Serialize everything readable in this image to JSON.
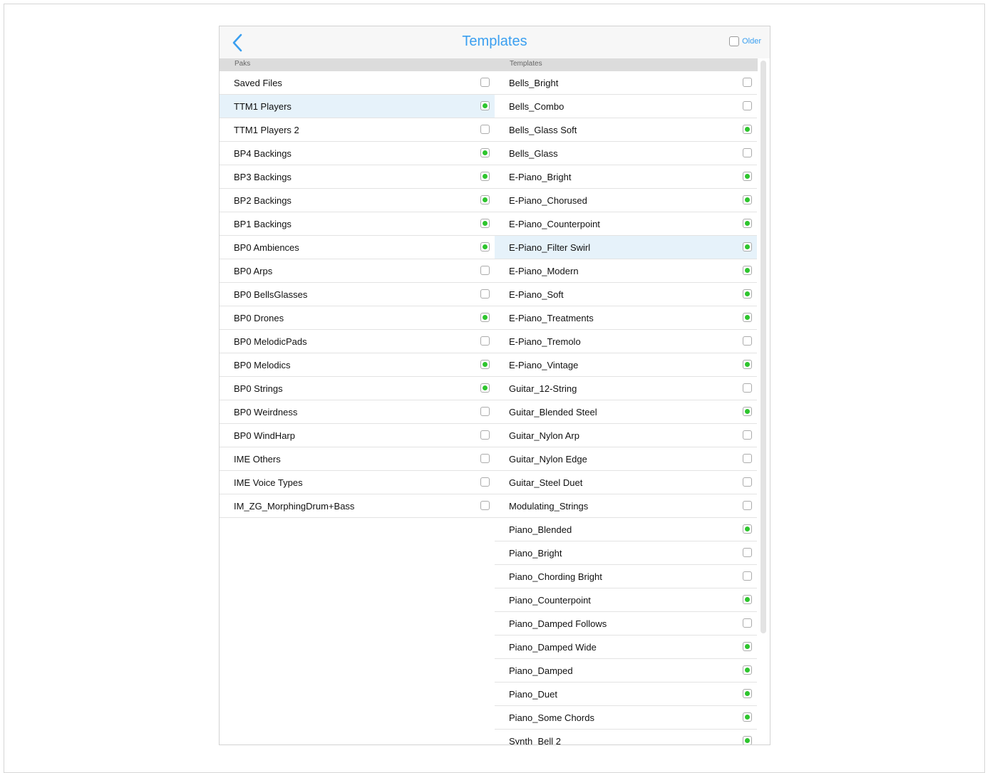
{
  "nav": {
    "title": "Templates",
    "older_label": "Older"
  },
  "columns": {
    "paks_header": "Paks",
    "templates_header": "Templates"
  },
  "colors": {
    "accent": "#3a9ff0",
    "enabled_dot": "#2ec52e",
    "selected_row": "#e6f2fa"
  },
  "paks": [
    {
      "label": "Saved Files",
      "checked": false,
      "selected": false
    },
    {
      "label": "TTM1 Players",
      "checked": true,
      "selected": true
    },
    {
      "label": "TTM1 Players 2",
      "checked": false,
      "selected": false
    },
    {
      "label": "BP4 Backings",
      "checked": true,
      "selected": false
    },
    {
      "label": "BP3 Backings",
      "checked": true,
      "selected": false
    },
    {
      "label": "BP2 Backings",
      "checked": true,
      "selected": false
    },
    {
      "label": "BP1 Backings",
      "checked": true,
      "selected": false
    },
    {
      "label": "BP0 Ambiences",
      "checked": true,
      "selected": false
    },
    {
      "label": "BP0 Arps",
      "checked": false,
      "selected": false
    },
    {
      "label": "BP0 BellsGlasses",
      "checked": false,
      "selected": false
    },
    {
      "label": "BP0 Drones",
      "checked": true,
      "selected": false
    },
    {
      "label": "BP0 MelodicPads",
      "checked": false,
      "selected": false
    },
    {
      "label": "BP0 Melodics",
      "checked": true,
      "selected": false
    },
    {
      "label": "BP0 Strings",
      "checked": true,
      "selected": false
    },
    {
      "label": "BP0 Weirdness",
      "checked": false,
      "selected": false
    },
    {
      "label": "BP0 WindHarp",
      "checked": false,
      "selected": false
    },
    {
      "label": "IME Others",
      "checked": false,
      "selected": false
    },
    {
      "label": "IME Voice Types",
      "checked": false,
      "selected": false
    },
    {
      "label": "IM_ZG_MorphingDrum+Bass",
      "checked": false,
      "selected": false
    }
  ],
  "templates": [
    {
      "label": "Bells_Bright",
      "checked": false,
      "selected": false
    },
    {
      "label": "Bells_Combo",
      "checked": false,
      "selected": false
    },
    {
      "label": "Bells_Glass Soft",
      "checked": true,
      "selected": false
    },
    {
      "label": "Bells_Glass",
      "checked": false,
      "selected": false
    },
    {
      "label": "E-Piano_Bright",
      "checked": true,
      "selected": false
    },
    {
      "label": "E-Piano_Chorused",
      "checked": true,
      "selected": false
    },
    {
      "label": "E-Piano_Counterpoint",
      "checked": true,
      "selected": false
    },
    {
      "label": "E-Piano_Filter Swirl",
      "checked": true,
      "selected": true
    },
    {
      "label": "E-Piano_Modern",
      "checked": true,
      "selected": false
    },
    {
      "label": "E-Piano_Soft",
      "checked": true,
      "selected": false
    },
    {
      "label": "E-Piano_Treatments",
      "checked": true,
      "selected": false
    },
    {
      "label": "E-Piano_Tremolo",
      "checked": false,
      "selected": false
    },
    {
      "label": "E-Piano_Vintage",
      "checked": true,
      "selected": false
    },
    {
      "label": "Guitar_12-String",
      "checked": false,
      "selected": false
    },
    {
      "label": "Guitar_Blended Steel",
      "checked": true,
      "selected": false
    },
    {
      "label": "Guitar_Nylon Arp",
      "checked": false,
      "selected": false
    },
    {
      "label": "Guitar_Nylon Edge",
      "checked": false,
      "selected": false
    },
    {
      "label": "Guitar_Steel Duet",
      "checked": false,
      "selected": false
    },
    {
      "label": "Modulating_Strings",
      "checked": false,
      "selected": false
    },
    {
      "label": "Piano_Blended",
      "checked": true,
      "selected": false
    },
    {
      "label": "Piano_Bright",
      "checked": false,
      "selected": false
    },
    {
      "label": "Piano_Chording Bright",
      "checked": false,
      "selected": false
    },
    {
      "label": "Piano_Counterpoint",
      "checked": true,
      "selected": false
    },
    {
      "label": "Piano_Damped Follows",
      "checked": false,
      "selected": false
    },
    {
      "label": "Piano_Damped Wide",
      "checked": true,
      "selected": false
    },
    {
      "label": "Piano_Damped",
      "checked": true,
      "selected": false
    },
    {
      "label": "Piano_Duet",
      "checked": true,
      "selected": false
    },
    {
      "label": "Piano_Some Chords",
      "checked": true,
      "selected": false
    },
    {
      "label": "Synth_Bell 2",
      "checked": true,
      "selected": false
    }
  ]
}
